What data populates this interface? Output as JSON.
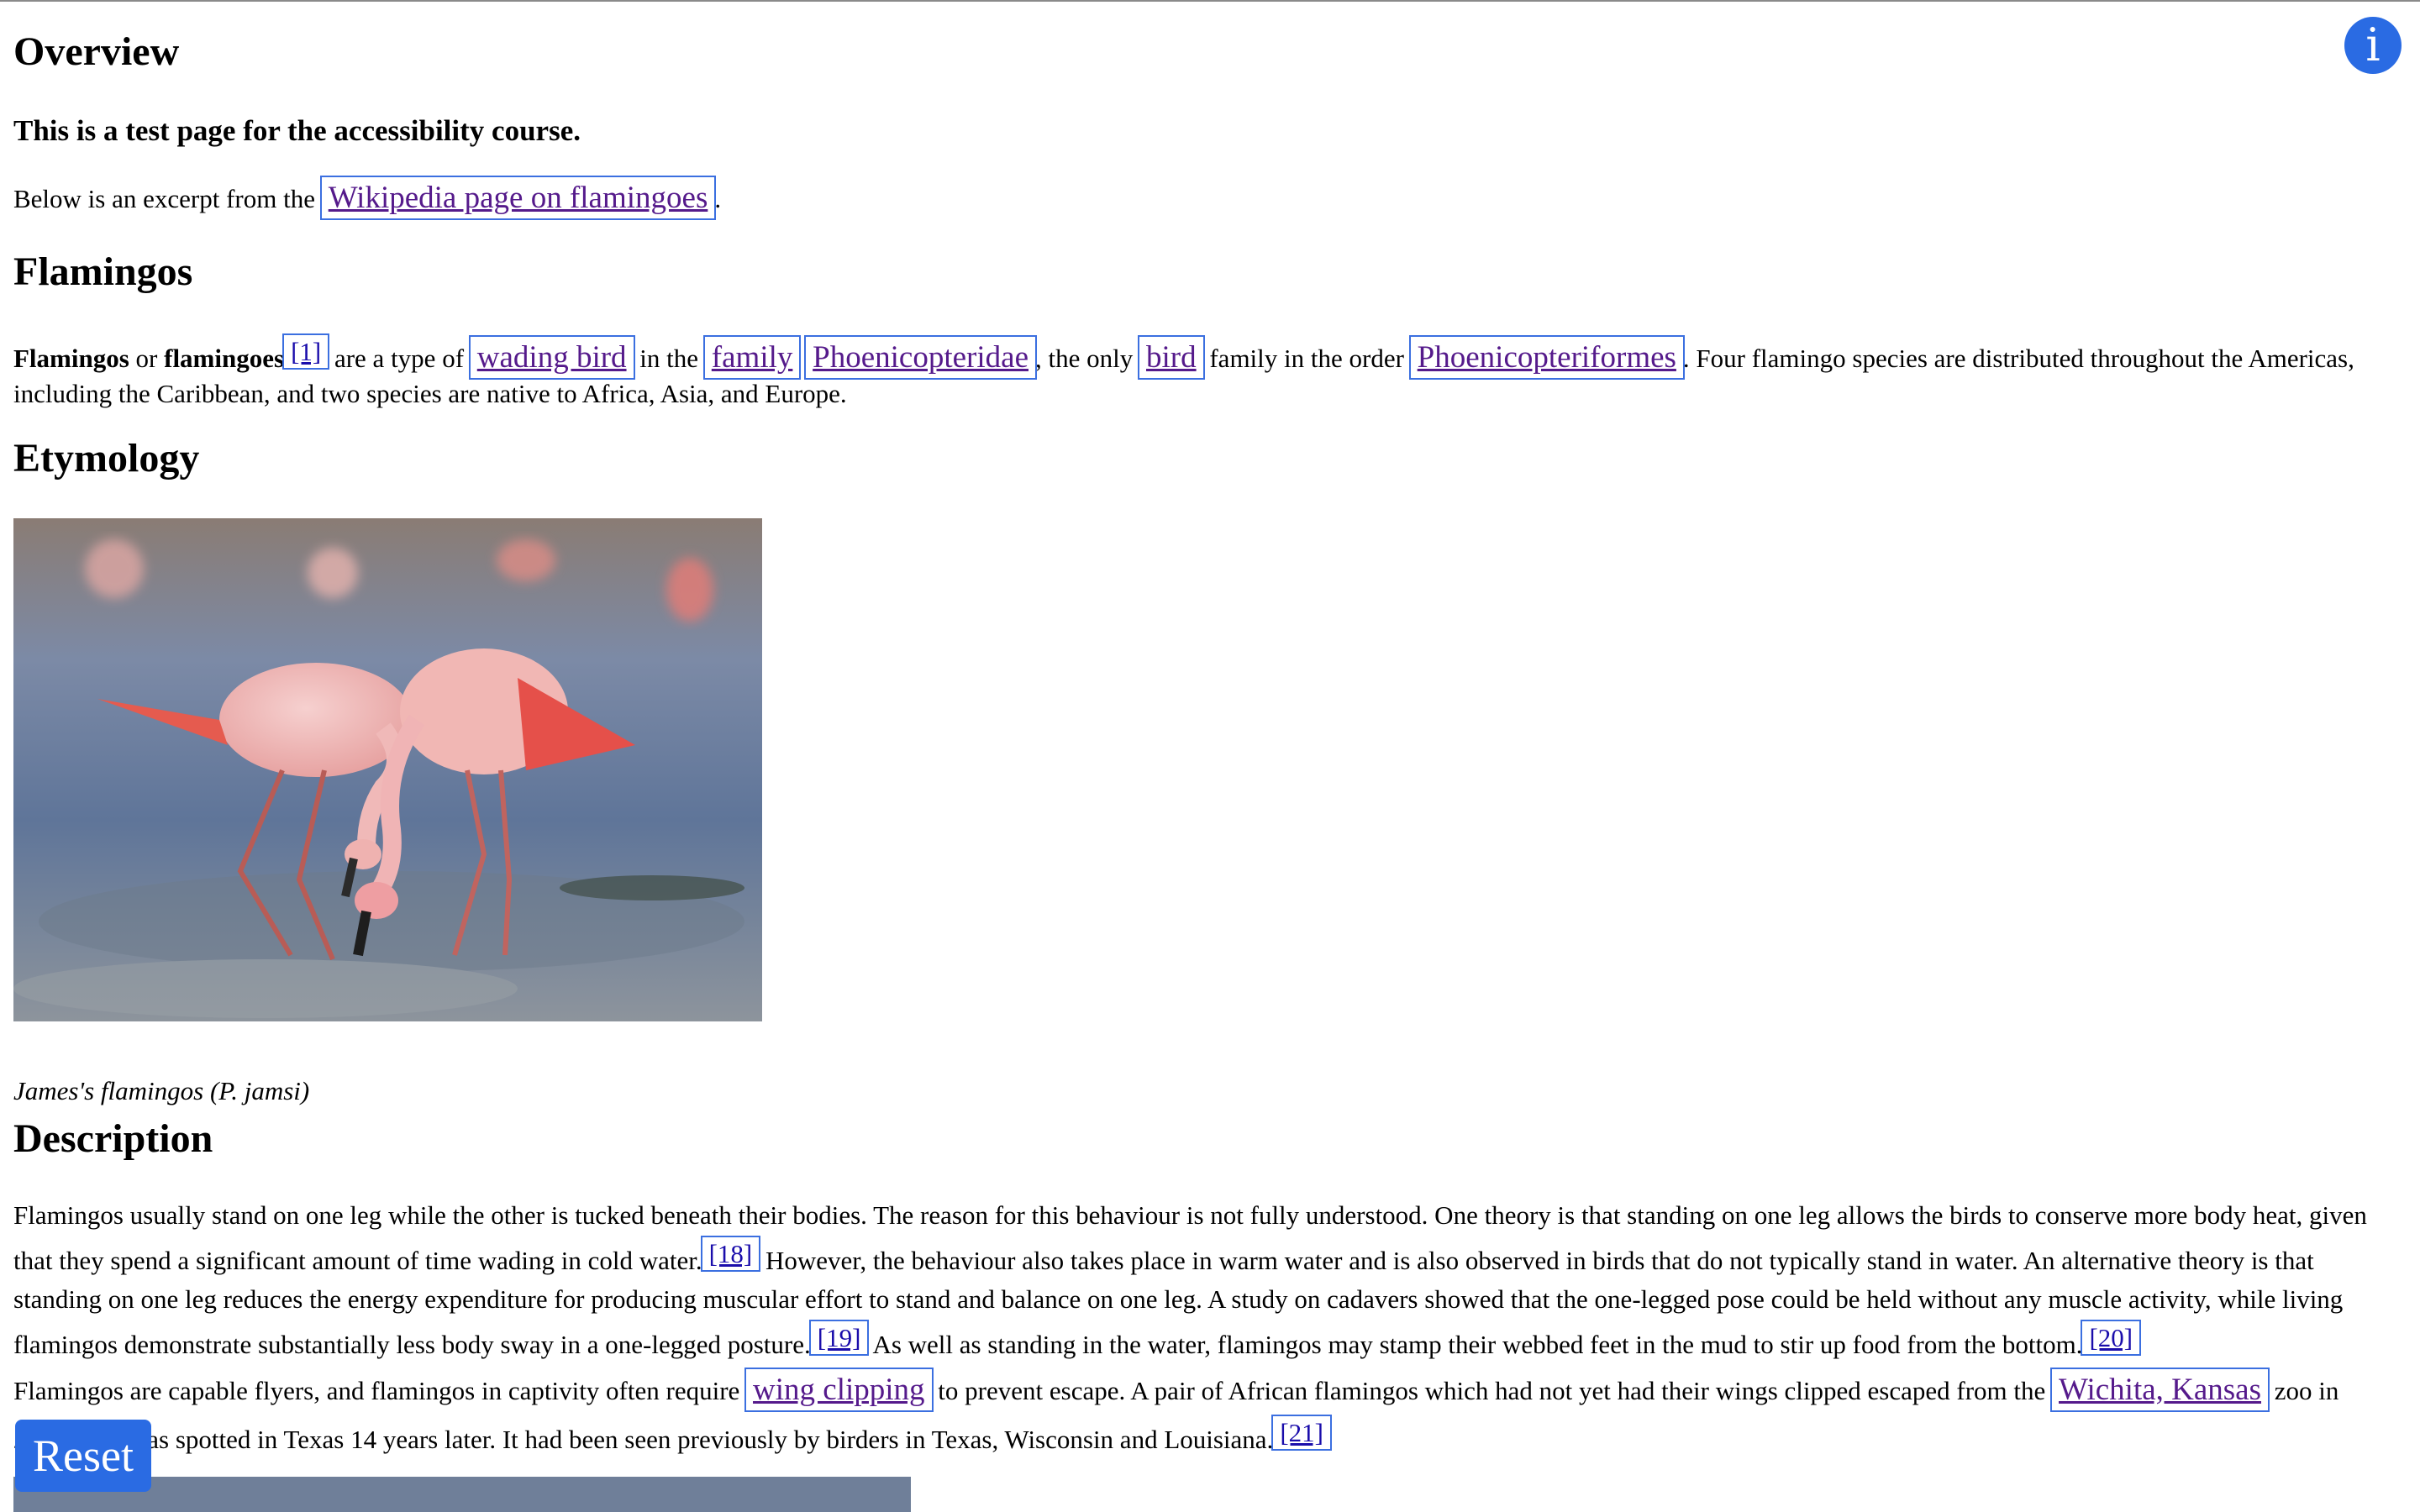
{
  "overview": {
    "heading": "Overview",
    "subtitle": "This is a test page for the accessibility course.",
    "intro_text": "Below is an excerpt from the ",
    "intro_link": "Wikipedia page on flamingoes",
    "intro_end": "."
  },
  "flamingos": {
    "heading": "Flamingos",
    "term1": "Flamingos",
    "or": " or ",
    "term2": "flamingoes",
    "ref1": "[1]",
    "t1": " are a type of ",
    "link_wading": "wading bird",
    "t2": " in the ",
    "link_family": "family",
    "link_phoenicopteridae": "Phoenicopteridae",
    "t3": ", the only ",
    "link_bird": "bird",
    "t4": " family in the order ",
    "link_order": "Phoenicopteriformes",
    "t5": ". Four flamingo species are distributed throughout the Americas, including the Caribbean, and two species are native to Africa, Asia, and Europe."
  },
  "etymology": {
    "heading": "Etymology",
    "caption": "James's flamingos (P. jamsi)"
  },
  "description": {
    "heading": "Description",
    "p1_a": "Flamingos usually stand on one leg while the other is tucked beneath their bodies. The reason for this behaviour is not fully understood. One theory is that standing on one leg allows the birds to conserve more body heat, given that they spend a significant amount of time wading in cold water.",
    "ref18": "[18]",
    "p1_b": " However, the behaviour also takes place in warm water and is also observed in birds that do not typically stand in water. An alternative theory is that standing on one leg reduces the energy expenditure for producing muscular effort to stand and balance on one leg. A study on cadavers showed that the one-legged pose could be held without any muscle activity, while living flamingos demonstrate substantially less body sway in a one-legged posture.",
    "ref19": "[19]",
    "p1_c": " As well as standing in the water, flamingos may stamp their webbed feet in the mud to stir up food from the bottom.",
    "ref20": "[20]",
    "p2_a": "Flamingos are capable flyers, and flamingos in captivity often require ",
    "link_wing": "wing clipping",
    "p2_b": " to prevent escape. A pair of African flamingos which had not yet had their wings clipped escaped from the ",
    "link_wichita": "Wichita, Kansas",
    "p2_c": " zoo in 2005. One was spotted in Texas 14 years later. It had been seen previously by birders in Texas, Wisconsin and Louisiana.",
    "ref21": "[21]"
  },
  "controls": {
    "info_icon": "i",
    "reset_label": "Reset"
  }
}
